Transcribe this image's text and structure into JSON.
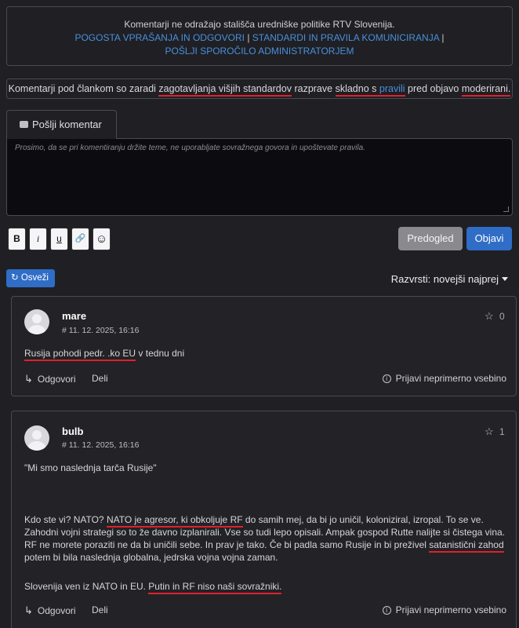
{
  "notice": {
    "disclaimer": "Komentarji ne odražajo stališča uredniške politike RTV Slovenija.",
    "link_faq": "POGOSTA VPRAŠANJA IN ODGOVORI",
    "separator": "|",
    "link_standards": "STANDARDI IN PRAVILA KOMUNICIRANJA",
    "link_admin": "POŠLJI SPOROČILO ADMINISTRATORJEM"
  },
  "moderation": {
    "text_1": "Komentarji pod člankom so zaradi",
    "text_2": "zagotavljanja višjih standardov",
    "text_3": "razprave",
    "text_4": "skladno s",
    "link_rules": "pravili",
    "text_5": "pred objavo",
    "text_6": "moderirani."
  },
  "composer": {
    "tab_label": "Pošlji komentar",
    "placeholder": "Prosimo, da se pri komentiranju držite teme, ne uporabljate sovražnega govora in upoštevate pravila.",
    "format_bold": "B",
    "format_italic": "i",
    "format_underline": "u",
    "format_link": "🔗",
    "format_emoji": "☺",
    "preview_label": "Predogled",
    "submit_label": "Objavi"
  },
  "list_controls": {
    "refresh_label": "Osveži",
    "refresh_icon": "↻",
    "sort_label": "Razvrsti: novejši najprej"
  },
  "comments": [
    {
      "user": "mare",
      "meta": "# 11. 12. 2025, 16:16",
      "votes": "0",
      "body_hl": "Rusija pohodi pedr. .ko EU",
      "body_rest": " v tednu dni",
      "reply": "Odgovori",
      "share": "Deli",
      "report": "Prijavi neprimerno vsebino"
    },
    {
      "user": "bulb",
      "meta": "# 11. 12. 2025, 16:16",
      "votes": "1",
      "quote": "\"Mi smo naslednja tarča Rusije\"",
      "p1_a": "Kdo ste vi? NATO? ",
      "p1_hl1": "NATO je agresor, ki obkoljuje RF",
      "p1_b": " do samih mej, da bi jo uničil, koloniziral, izropal. To se ve. Zahodni vojni strategi so to že davno izplanirali. Vse so tudi lepo opisali. Ampak gospod Rutte nalijte si čistega vina. RF ne morete poraziti ne da bi uničili sebe. In prav je tako. Če bi padla samo Rusije in bi preživel ",
      "p1_hl2": "satanistični zahod",
      "p1_c": " potem bi bila naslednja globalna, jedrska vojna vojna zaman.",
      "p2_a": "Slovenija ven iz NATO in EU. ",
      "p2_hl": "Putin in RF niso naši sovražniki.",
      "reply": "Odgovori",
      "share": "Deli",
      "report": "Prijavi neprimerno vsebino"
    }
  ],
  "colors": {
    "background": "#1f1f24",
    "link": "#4a90d9",
    "primary_button": "#2f6dc6",
    "secondary_button": "#8a8a8e",
    "highlight_underline": "#e0212b"
  },
  "icons": [
    "comment-icon",
    "refresh-icon",
    "caret-down-icon",
    "star-icon",
    "reply-icon",
    "info-icon",
    "avatar-icon",
    "resize-handle-icon"
  ]
}
